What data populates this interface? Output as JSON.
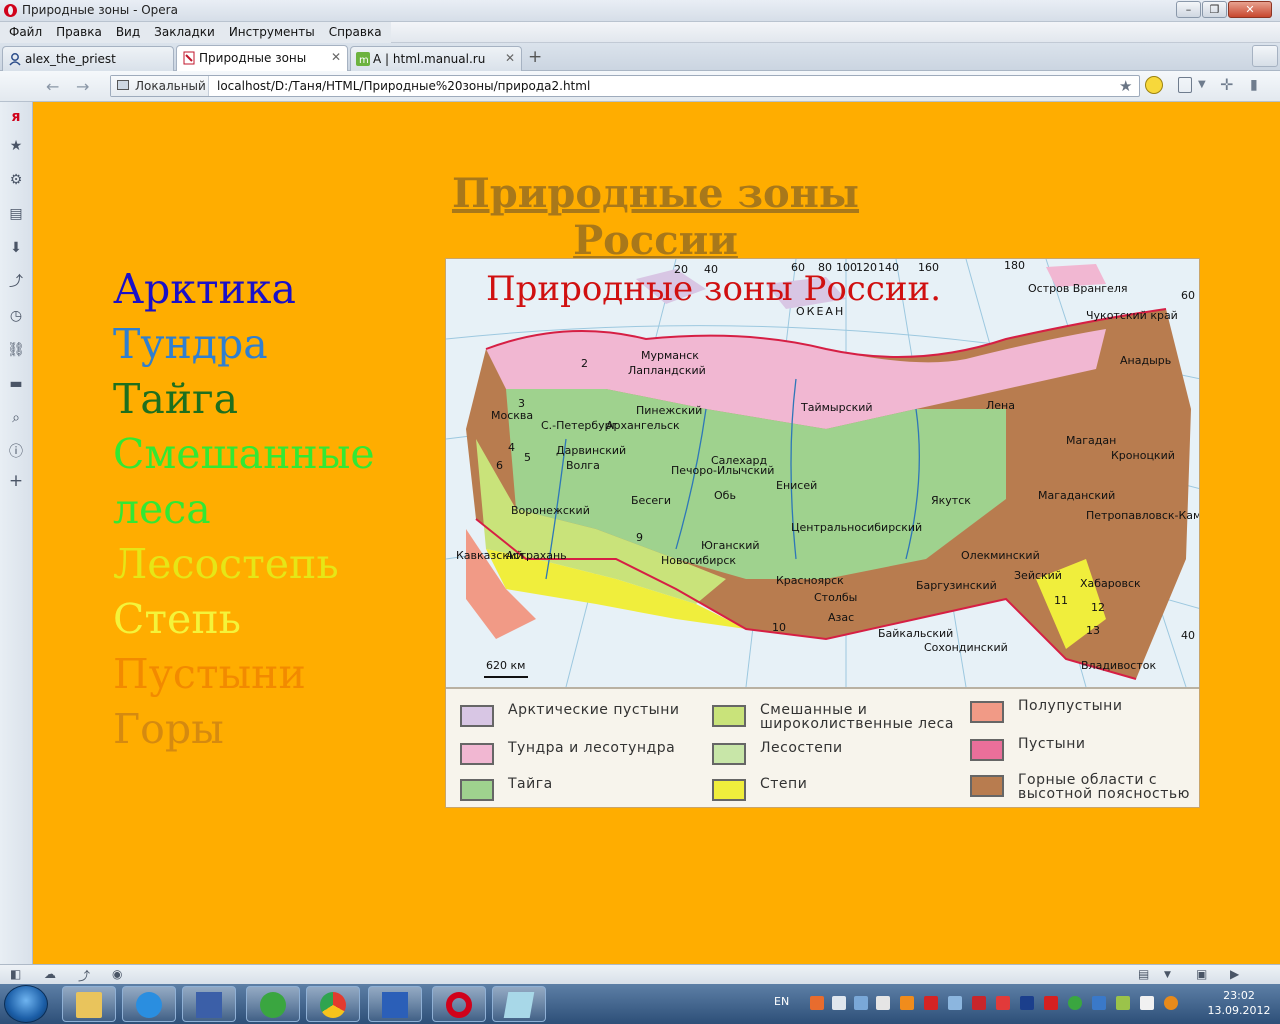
{
  "window": {
    "title": "Природные зоны - Opera"
  },
  "menu": [
    "Файл",
    "Правка",
    "Вид",
    "Закладки",
    "Инструменты",
    "Справка"
  ],
  "tabs": [
    {
      "label": "alex_the_priest",
      "active": false
    },
    {
      "label": "Природные зоны",
      "active": true
    },
    {
      "label": "A | html.manual.ru",
      "active": false
    }
  ],
  "address": {
    "badge": "Локальный",
    "url": "localhost/D:/Таня/HTML/Природные%20зоны/природа2.html"
  },
  "page": {
    "title": "Природные зоны России",
    "background": "#ffad00",
    "zones": [
      {
        "label": "Арктика",
        "color": "#1a10c8"
      },
      {
        "label": "Тундра",
        "color": "#2f7fd0"
      },
      {
        "label": "Тайга",
        "color": "#1e6f1e"
      },
      {
        "label": "Смешанные",
        "color": "#33e833"
      },
      {
        "label": "леса",
        "color": "#33e833"
      },
      {
        "label": "Лесостепь",
        "color": "#e6e616"
      },
      {
        "label": "Степь",
        "color": "#f4f43a"
      },
      {
        "label": "Пустыни",
        "color": "#f28a00"
      },
      {
        "label": "Горы",
        "color": "#d58a10"
      }
    ]
  },
  "map": {
    "title": "Природные зоны России.",
    "ocean": "ОКЕАН",
    "scale": "620 км",
    "degrees": [
      "20",
      "40",
      "60",
      "80",
      "100",
      "120",
      "140",
      "160",
      "180",
      "60",
      "40"
    ],
    "places": [
      "Остров Врангеля",
      "Таймырский",
      "Мурманск",
      "Лапландский",
      "Архангельск",
      "Пинежский",
      "С.-Петербург",
      "Дарвинский",
      "Москва",
      "Воронежский",
      "Кавказский",
      "Астрахань",
      "Печоро-Илычский",
      "Салехард",
      "Бесеги",
      "Юганский",
      "Новосибирск",
      "Центральносибирский",
      "Красноярск",
      "Столбы",
      "Азас",
      "Байкальский",
      "Сохондинский",
      "Баргузинский",
      "Олекминский",
      "Якутск",
      "Магаданский",
      "Магадан",
      "Зейский",
      "Хабаровск",
      "Владивосток",
      "Кроноцкий",
      "Петропавловск-Камчатский",
      "Анадырь",
      "Обь",
      "Енисей",
      "Волга",
      "Лена",
      "Чукотский край"
    ],
    "numbers": [
      "2",
      "3",
      "4",
      "5",
      "6",
      "9",
      "10",
      "11",
      "12",
      "13"
    ],
    "legend": [
      {
        "label": "Арктические пустыни",
        "color": "#d8c6e4"
      },
      {
        "label": "Тундра и лесотундра",
        "color": "#f1b7d2"
      },
      {
        "label": "Тайга",
        "color": "#9fd28e"
      },
      {
        "label": "Смешанные и широколиственные леса",
        "color": "#c9e37a"
      },
      {
        "label": "Лесостепи",
        "color": "#c8e6a8"
      },
      {
        "label": "Степи",
        "color": "#f0ee3c"
      },
      {
        "label": "Полупустыни",
        "color": "#f19a86"
      },
      {
        "label": "Пустыни",
        "color": "#ea6f9a"
      },
      {
        "label": "Горные области с высотной поясностью",
        "color": "#b87c4f"
      }
    ]
  },
  "taskbar": {
    "lang": "EN",
    "time": "23:02",
    "date": "13.09.2012"
  }
}
